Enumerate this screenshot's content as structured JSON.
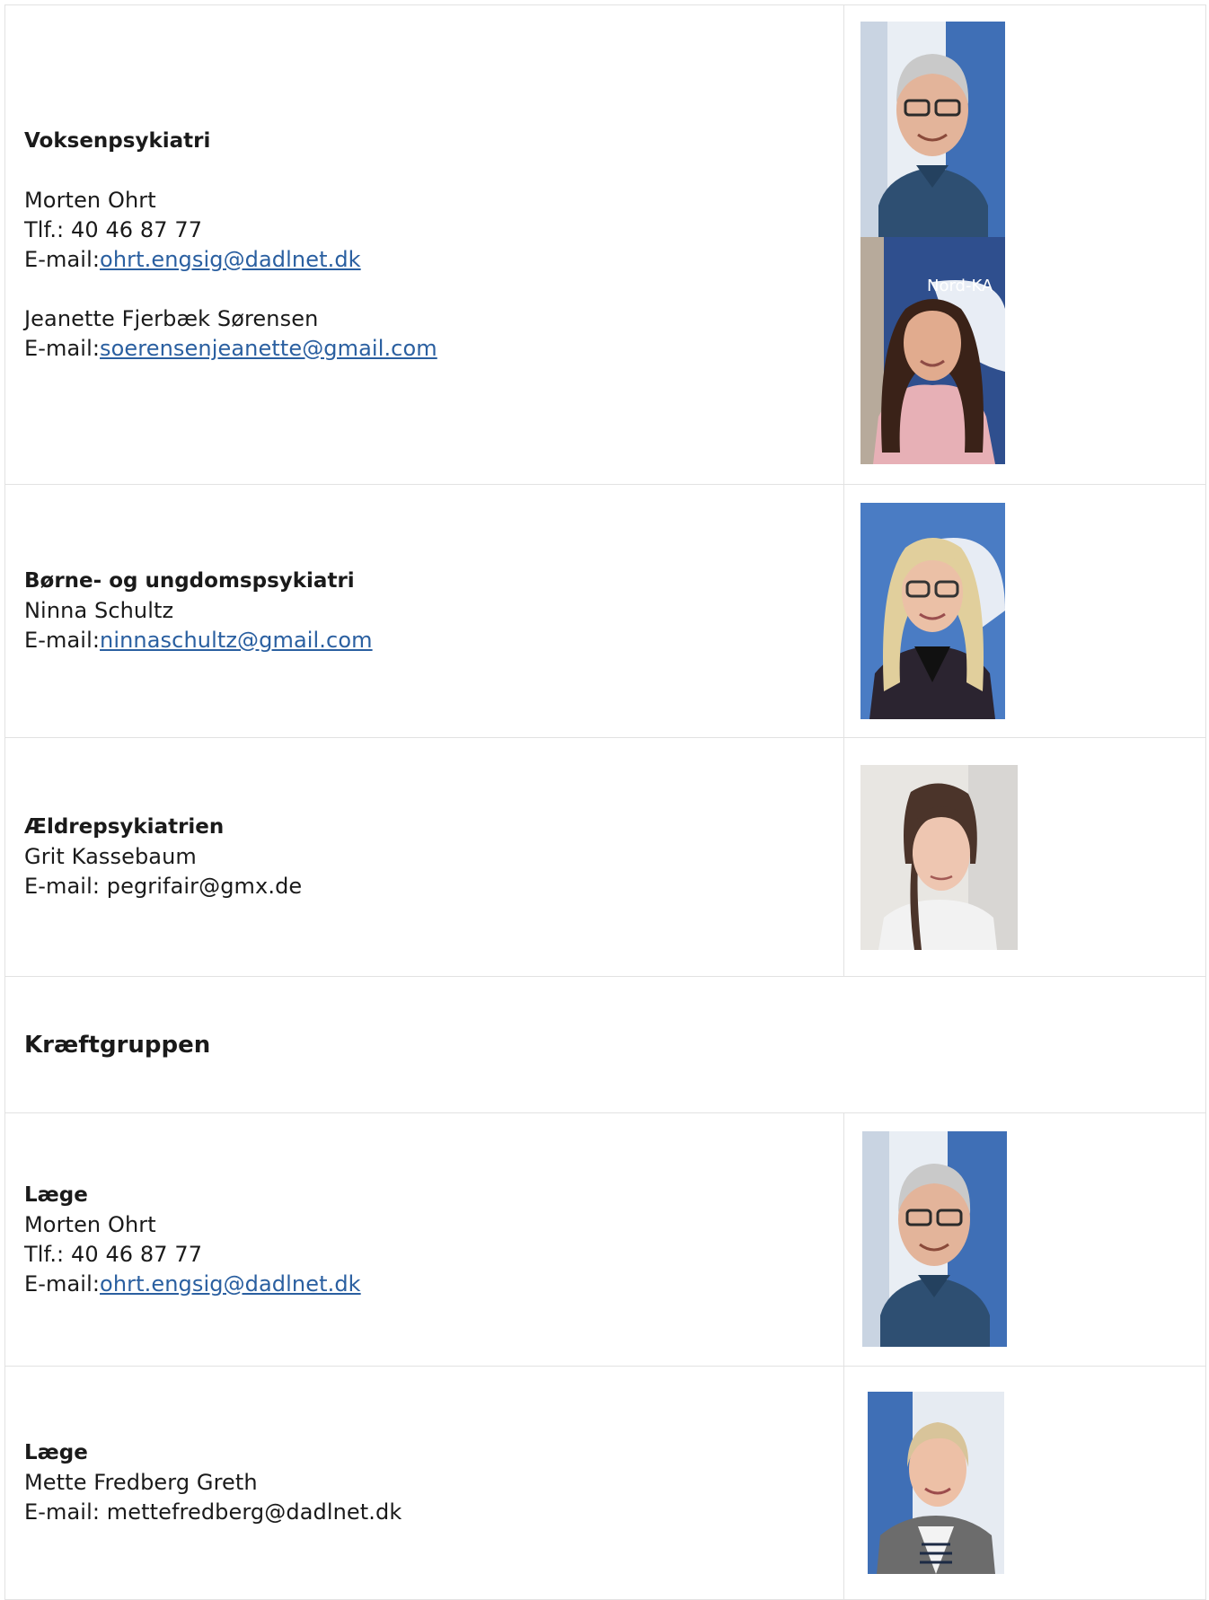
{
  "rows": [
    {
      "heading": "Voksenpsykiatri",
      "people": [
        {
          "name": "Morten Ohrt",
          "phone": "Tlf.: 40 46 87 77",
          "email_prefix": "E-mail:",
          "email": "ohrt.engsig@dadlnet.dk"
        },
        {
          "name": "Jeanette Fjerbæk Sørensen",
          "email_prefix": "E-mail:",
          "email": "soerensenjeanette@gmail.com"
        }
      ],
      "photos": [
        "portrait-older-man-glasses",
        "portrait-woman-dark-hair"
      ],
      "photo_banner_text": "Nord-KA"
    },
    {
      "heading": "Børne- og ungdomspsykiatri",
      "person": {
        "name": "Ninna Schultz",
        "email_prefix": "E-mail:",
        "email": "ninnaschultz@gmail.com"
      },
      "photos": [
        "portrait-blonde-woman-glasses"
      ]
    },
    {
      "heading": "Ældrepsykiatrien",
      "person": {
        "name": "Grit Kassebaum",
        "email_line": "E-mail: pegrifair@gmx.de"
      },
      "photos": [
        "portrait-young-woman"
      ]
    },
    {
      "section": "Kræftgruppen"
    },
    {
      "heading": "Læge",
      "person": {
        "name": "Morten Ohrt",
        "phone": "Tlf.: 40 46 87 77",
        "email_prefix": "E-mail:",
        "email": "ohrt.engsig@dadlnet.dk"
      },
      "photos": [
        "portrait-older-man-glasses"
      ]
    },
    {
      "heading": "Læge",
      "person": {
        "name": "Mette Fredberg Greth",
        "email_line": "E-mail: mettefredberg@dadlnet.dk"
      },
      "photos": [
        "portrait-woman-short-blonde"
      ]
    }
  ],
  "colors": {
    "link": "#2a5fa0",
    "border": "#e2e2e2",
    "text": "#1a1a1a"
  }
}
